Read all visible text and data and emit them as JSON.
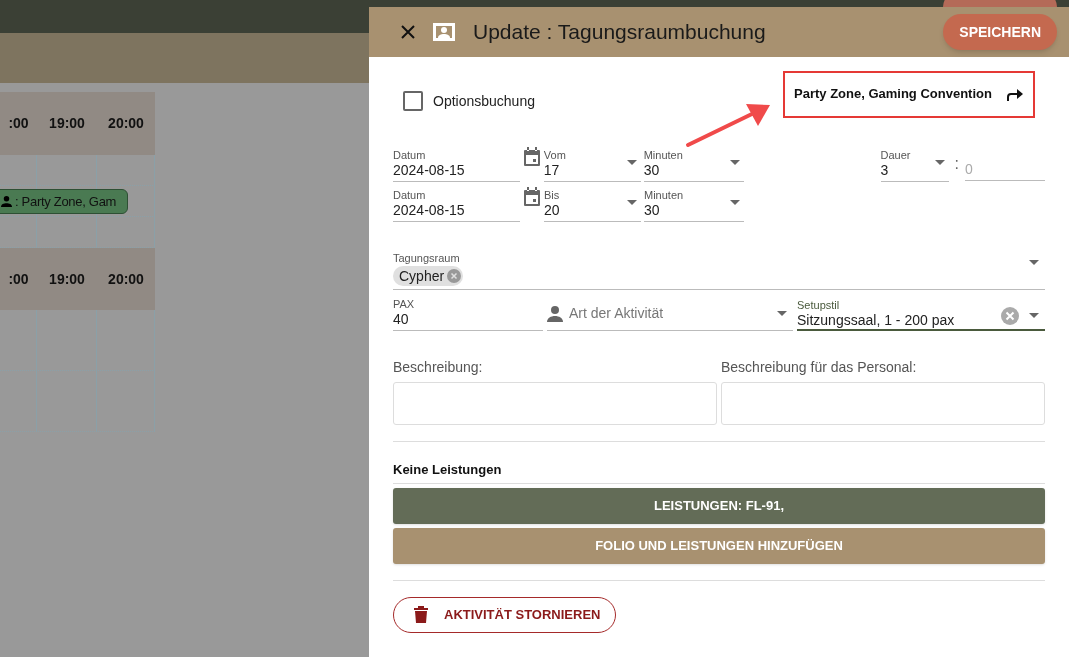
{
  "background": {
    "schedules": [
      {
        "times": [
          ":00",
          "19:00",
          "20:00"
        ],
        "event": {
          "label": ": Party Zone, Gam"
        }
      },
      {
        "times": [
          ":00",
          "19:00",
          "20:00"
        ]
      }
    ]
  },
  "dialog": {
    "title": "Update : Tagungsraumbuchung",
    "save": "SPEICHERN",
    "option": {
      "label": "Optionsbuchung",
      "checked": false
    },
    "linked_event": "Party Zone, Gaming Convention",
    "start": {
      "date_label": "Datum",
      "date": "2024-08-15",
      "hour_label": "Vom",
      "hour": "17",
      "min_label": "Minuten",
      "min": "30"
    },
    "end": {
      "date_label": "Datum",
      "date": "2024-08-15",
      "hour_label": "Bis",
      "hour": "20",
      "min_label": "Minuten",
      "min": "30"
    },
    "duration": {
      "label": "Dauer",
      "hours": "3",
      "sep": ":",
      "minutes_placeholder": "0"
    },
    "room": {
      "label": "Tagungsraum",
      "chips": [
        "Cypher"
      ]
    },
    "pax": {
      "label": "PAX",
      "value": "40"
    },
    "activity": {
      "placeholder": "Art der Aktivität"
    },
    "setup": {
      "label": "Setupstil",
      "value": "Sitzungssaal, 1 - 200 pax"
    },
    "description": {
      "label": "Beschreibung:"
    },
    "staff_description": {
      "label": "Beschreibung für das Personal:"
    },
    "services_heading": "Keine Leistungen",
    "services_button": "LEISTUNGEN: FL-91,",
    "folio_button": "FOLIO UND LEISTUNGEN HINZUFÜGEN",
    "cancel_button": "AKTIVITÄT STORNIEREN"
  }
}
